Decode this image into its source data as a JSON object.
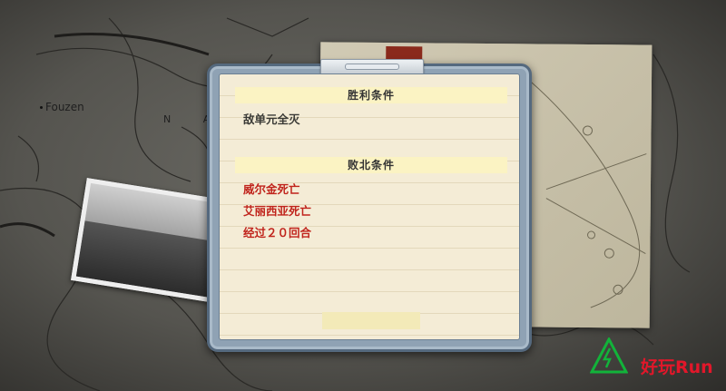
{
  "map": {
    "town_label": "Fouzen",
    "region_label": "N A"
  },
  "dialog": {
    "victory_header": "胜利条件",
    "victory_conditions": [
      "敌单元全灭"
    ],
    "defeat_header": "败北条件",
    "defeat_conditions": [
      "威尔金死亡",
      "艾丽西亚死亡",
      "经过２０回合"
    ]
  },
  "watermark": {
    "logo_text": "好玩",
    "brand_text": "好玩Run"
  },
  "colors": {
    "defeat_text": "#c0241c",
    "victory_text": "#3a3a36",
    "header_bg": "#fbf3c3",
    "frame": "#8fa2b4",
    "watermark_red": "#e2172a",
    "watermark_green": "#12b33a"
  }
}
